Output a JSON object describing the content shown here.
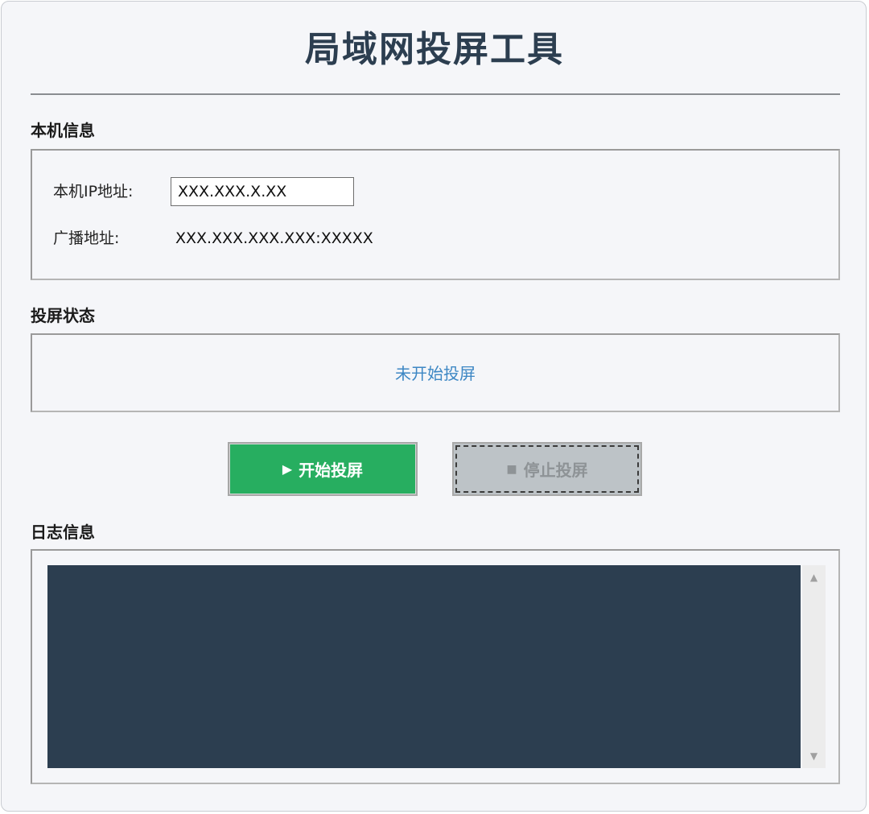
{
  "app": {
    "title": "局域网投屏工具"
  },
  "local_info": {
    "section_label": "本机信息",
    "ip_label": "本机IP地址:",
    "ip_value": "XXX.XXX.X.XX",
    "broadcast_label": "广播地址:",
    "broadcast_value": "XXX.XXX.XXX.XXX:XXXXX"
  },
  "cast_status": {
    "section_label": "投屏状态",
    "status_text": "未开始投屏"
  },
  "controls": {
    "start_label": "开始投屏",
    "start_icon": "▶",
    "stop_label": "停止投屏",
    "stop_icon": "■",
    "stop_enabled": false
  },
  "log": {
    "section_label": "日志信息",
    "content": ""
  },
  "colors": {
    "title": "#2c3e50",
    "start_button": "#27ae60",
    "stop_button_disabled": "#bdc3c7",
    "status_text": "#3d87c4",
    "log_background": "#2c3e50"
  }
}
